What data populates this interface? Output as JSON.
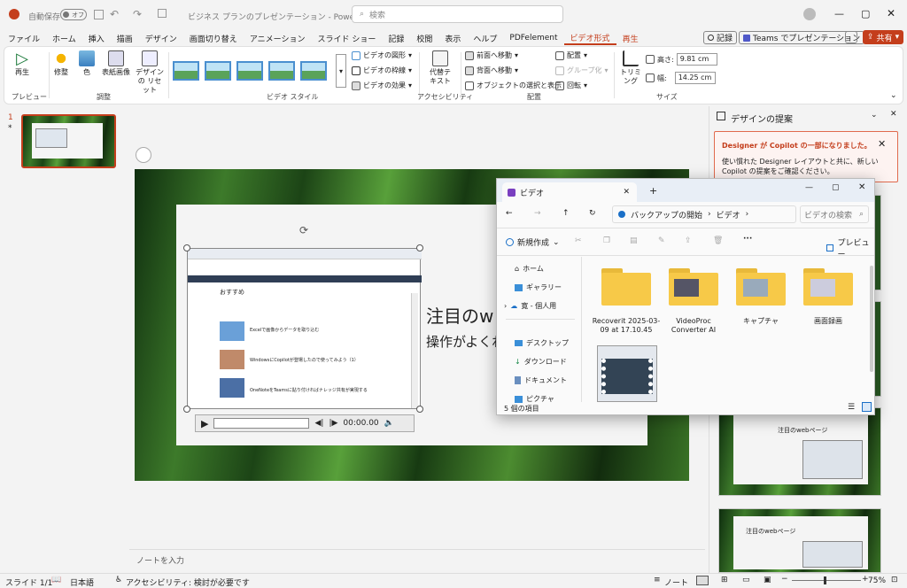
{
  "titlebar": {
    "autosave_label": "自動保存",
    "autosave_state": "オフ",
    "doc_title": "ビジネス プランのプレゼンテーション - PowerPoint",
    "search_placeholder": "検索"
  },
  "tabs": [
    "ファイル",
    "ホーム",
    "挿入",
    "描画",
    "デザイン",
    "画面切り替え",
    "アニメーション",
    "スライド ショー",
    "記録",
    "校閲",
    "表示",
    "ヘルプ",
    "PDFelement",
    "ビデオ形式",
    "再生"
  ],
  "tab_right": {
    "record": "記録",
    "teams": "Teams でプレゼンテーション",
    "share": "共有"
  },
  "ribbon": {
    "play": "再生",
    "preview_group": "プレビュー",
    "correct": "修整",
    "color": "色",
    "poster": "表紙画像",
    "reset": "デザインの リセット",
    "adjust_group": "調整",
    "video_shape": "ビデオの図形",
    "video_border": "ビデオの枠線",
    "video_effect": "ビデオの効果",
    "style_group": "ビデオ スタイル",
    "alt_text": "代替テ キスト",
    "access_group": "アクセシビリティ",
    "forward": "前面へ移動",
    "backward": "背面へ移動",
    "select_pane": "オブジェクトの選択と表示",
    "align": "配置",
    "group": "グループ化",
    "rotate": "回転",
    "arrange_group": "配置",
    "crop": "トリミング",
    "height_label": "高さ:",
    "height_val": "9.81 cm",
    "width_label": "幅:",
    "width_val": "14.25 cm",
    "size_group": "サイズ"
  },
  "thumb": {
    "num": "1",
    "star": "*"
  },
  "slide": {
    "title": "注目のw",
    "subtitle": "操作がよくわ",
    "video_time": "00:00.00",
    "web_header": "おすすめ",
    "web_items": [
      "Excelで画像からデータを取り込む",
      "WindowsにCopilotが登場したので使ってみよう（1）",
      "OneNoteをTeamsに貼り付ければナレッジ共有が実現する"
    ]
  },
  "notes_placeholder": "ノートを入力",
  "design": {
    "title": "デザインの提案",
    "banner_title": "Designer が Copilot の一部になりました。",
    "banner_body": "使い慣れた Designer レイアウトと共に、新しい Copilot の提案をご確認ください。",
    "card_title": "注目のwebページ"
  },
  "explorer": {
    "tab_title": "ビデオ",
    "path": [
      "バックアップの開始",
      "ビデオ"
    ],
    "search_placeholder": "ビデオの検索",
    "new_label": "新規作成",
    "preview_label": "プレビュー",
    "nav": [
      "ホーム",
      "ギャラリー",
      "寛 - 個人用",
      "デスクトップ",
      "ダウンロード",
      "ドキュメント",
      "ピクチャ"
    ],
    "items": [
      "Recoverit 2025-03-09 at 17.10.45",
      "VideoProc Converter AI",
      "キャプチャ",
      "画面録画"
    ],
    "count": "5 個の項目"
  },
  "status": {
    "slide": "スライド 1/1",
    "lang": "日本語",
    "access": "アクセシビリティ: 検討が必要です",
    "notes": "ノート",
    "zoom": "75%"
  },
  "colors": {
    "accent": "#c43e1c",
    "ribbon_tab_active": "#c43e1c"
  }
}
